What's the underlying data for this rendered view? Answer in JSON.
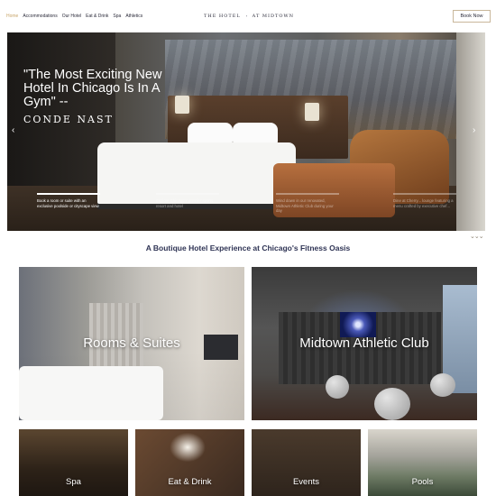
{
  "header": {
    "nav": [
      "Home",
      "Accommodations",
      "Our Hotel",
      "Eat & Drink",
      "Spa",
      "Athletics"
    ],
    "logo_left": "THE HOTEL",
    "logo_right": "AT MIDTOWN",
    "book_label": "Book Now"
  },
  "hero": {
    "quote": "\"The Most Exciting New Hotel In Chicago Is In A Gym\" --",
    "source": "CONDE NAST",
    "arrow_left": "‹",
    "arrow_right": "›",
    "captions": [
      "Book a room or suite with an exclusive poolside or cityscape view",
      "Explore Chicago's premier sports resort and hotel",
      "Wind down in our renovated, Midtown Athletic Club during your day",
      "Dine at Cherry... lounge featuring a menu crafted by executive chef..."
    ],
    "scroll_indicator": "⌄⌄⌄"
  },
  "tagline": "A Boutique Hotel Experience at Chicago's Fitness Oasis",
  "tiles": {
    "rooms": "Rooms & Suites",
    "athletic": "Midtown Athletic Club",
    "spa": "Spa",
    "eat": "Eat & Drink",
    "events": "Events",
    "pools": "Pools"
  }
}
